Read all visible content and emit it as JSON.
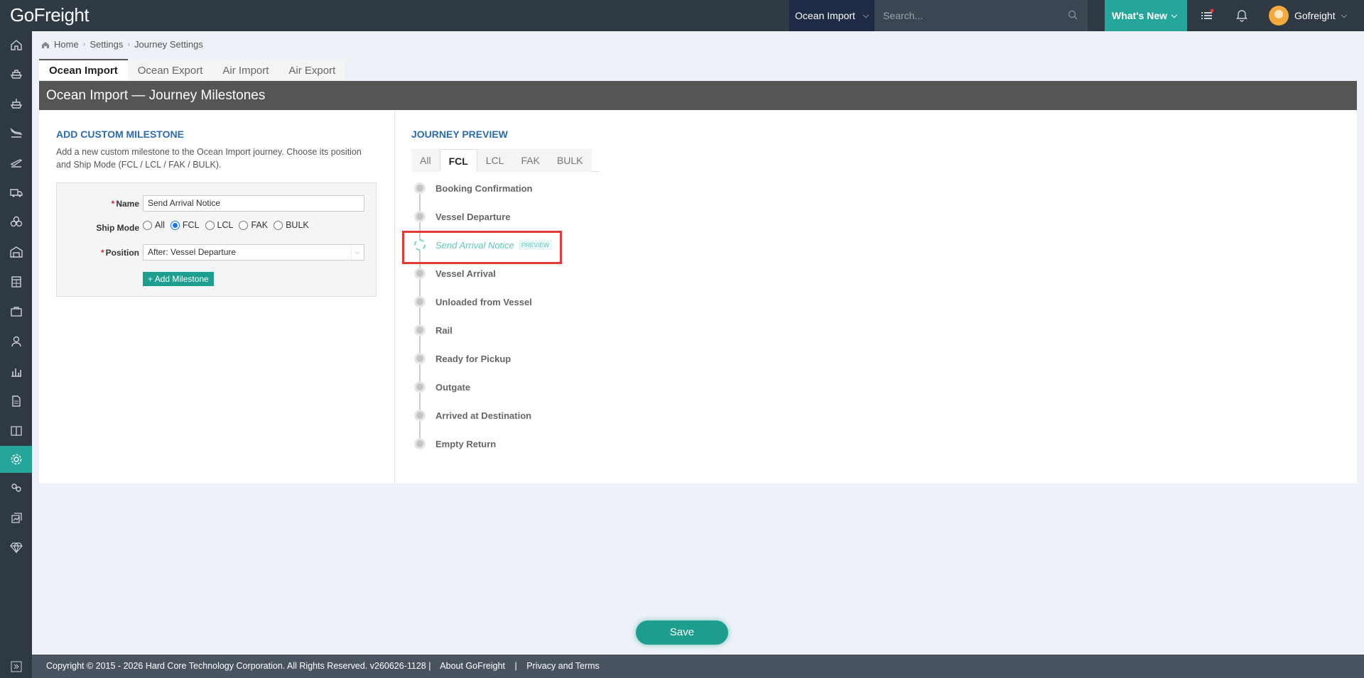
{
  "brand": {
    "logo_text": "GoFreight"
  },
  "topbar": {
    "module": "Ocean Import",
    "search_placeholder": "Search...",
    "whats_new": "What's New",
    "user_name": "Gofreight"
  },
  "breadcrumb": {
    "home": "Home",
    "settings": "Settings",
    "current": "Journey Settings"
  },
  "tabs": [
    "Ocean Import",
    "Ocean Export",
    "Air Import",
    "Air Export"
  ],
  "panel": {
    "title": "Ocean Import — Journey Milestones"
  },
  "add_section": {
    "title": "ADD CUSTOM MILESTONE",
    "description": "Add a new custom milestone to the Ocean Import journey. Choose its position and Ship Mode (FCL / LCL / FAK / BULK).",
    "name_label": "Name",
    "name_value": "Send Arrival Notice",
    "ship_mode_label": "Ship Mode",
    "ship_modes": [
      "All",
      "FCL",
      "LCL",
      "FAK",
      "BULK"
    ],
    "ship_mode_selected": "FCL",
    "position_label": "Position",
    "position_value": "After: Vessel Departure",
    "add_button": "Add Milestone"
  },
  "preview_section": {
    "title": "JOURNEY PREVIEW",
    "tabs": [
      "All",
      "FCL",
      "LCL",
      "FAK",
      "BULK"
    ],
    "active_tab": "FCL",
    "milestones": [
      "Booking Confirmation",
      "Vessel Departure",
      "Send Arrival Notice",
      "Vessel Arrival",
      "Unloaded from Vessel",
      "Rail",
      "Ready for Pickup",
      "Outgate",
      "Arrived at Destination",
      "Empty Return"
    ],
    "preview_badge": "PREVIEW"
  },
  "save_button": "Save",
  "footer": {
    "copyright": "Copyright © 2015 - 2026 Hard Core Technology Corporation. All Rights Reserved. v260626-1128 |",
    "about": "About GoFreight",
    "separator": "|",
    "privacy": "Privacy and Terms"
  },
  "colors": {
    "accent": "#26a69a",
    "topbar": "#2e3943",
    "title_blue": "#2b6cb0",
    "highlight": "#e53935"
  }
}
